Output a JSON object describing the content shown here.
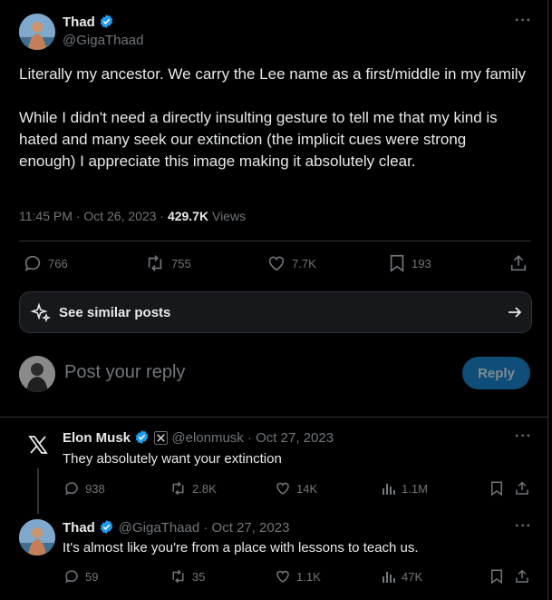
{
  "colors": {
    "bg": "#000000",
    "text": "#e7e9ea",
    "muted": "#71767b",
    "verified": "#1d9bf0",
    "reply_btn_bg": "#0f4e78",
    "border": "#2f3336"
  },
  "main_tweet": {
    "author_name": "Thad",
    "author_handle": "@GigaThaad",
    "text_p1": "Literally my ancestor. We carry the Lee name as a first/middle in my family",
    "text_p2": "While I didn't need a directly insulting gesture to tell me that my kind is hated and many seek our extinction (the implicit cues were strong enough) I appreciate this image making it absolutely clear.",
    "timestamp": "11:45 PM · Oct 26, 2023 · ",
    "views_count": "429.7K",
    "views_label": " Views",
    "replies": "766",
    "reposts": "755",
    "likes": "7.7K",
    "bookmarks": "193"
  },
  "similar": {
    "label": "See similar posts"
  },
  "composer": {
    "placeholder": "Post your reply",
    "button": "Reply"
  },
  "replies": [
    {
      "author_name": "Elon Musk",
      "author_handle": "@elonmusk",
      "date": " · Oct 27, 2023",
      "text": "They absolutely want your extinction",
      "replies": "938",
      "reposts": "2.8K",
      "likes": "14K",
      "views": "1.1M"
    },
    {
      "author_name": "Thad",
      "author_handle": "@GigaThaad",
      "date": " · Oct 27, 2023",
      "text": "It's almost like you're from a place with lessons to teach us.",
      "replies": "59",
      "reposts": "35",
      "likes": "1.1K",
      "views": "47K"
    }
  ]
}
